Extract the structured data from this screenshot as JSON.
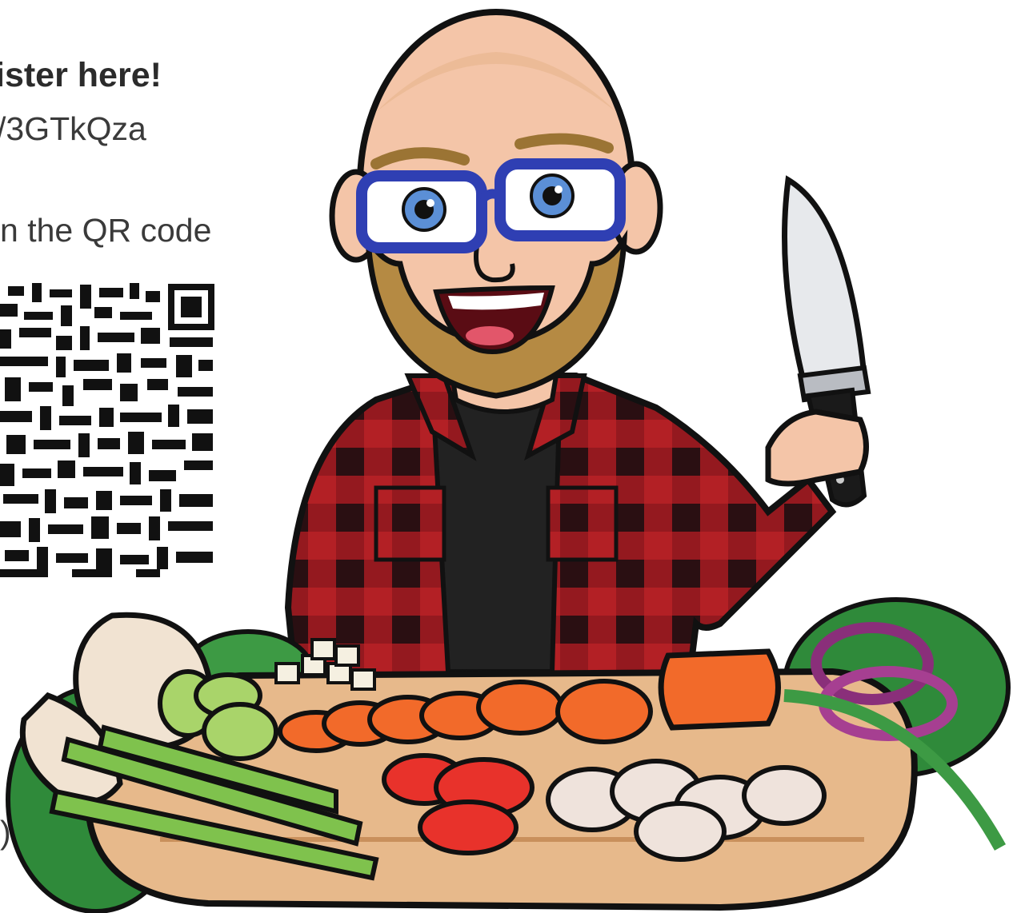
{
  "slide": {
    "heading": "ister here!",
    "link_text": "/3GTkQza",
    "scan_text": "n the QR code",
    "trailing_mark": ")"
  },
  "icons": {
    "qr": "qr-code-icon",
    "illustration": "chef-avatar-illustration"
  },
  "colors": {
    "text": "#3a3a3a",
    "shirt_red": "#b32025",
    "shirt_dark": "#2a0f12",
    "glasses_blue": "#2f3fb3",
    "beard": "#b58a43",
    "skin": "#f4c5a8",
    "board": "#e7b98b",
    "carrot": "#f26a2a"
  }
}
